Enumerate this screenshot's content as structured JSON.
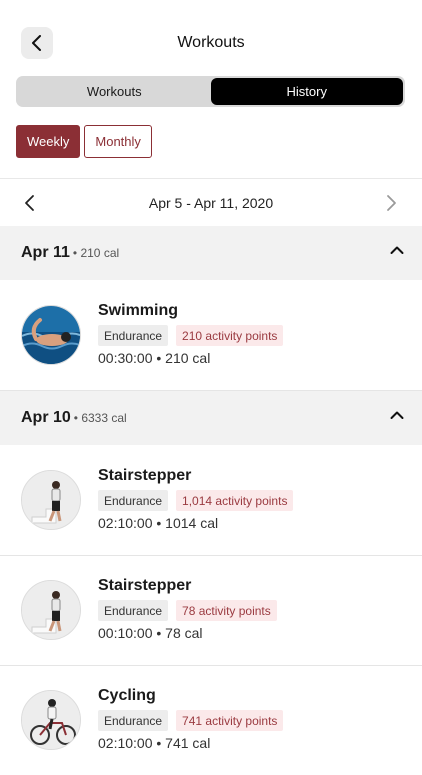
{
  "header": {
    "title": "Workouts"
  },
  "tabs": [
    {
      "label": "Workouts",
      "active": false
    },
    {
      "label": "History",
      "active": true
    }
  ],
  "period": {
    "weekly": "Weekly",
    "monthly": "Monthly"
  },
  "range": {
    "label": "Apr 5 - Apr 11, 2020"
  },
  "days": [
    {
      "date": "Apr 11",
      "cal": "• 210 cal",
      "workouts": [
        {
          "name": "Swimming",
          "category": "Endurance",
          "points": "210 activity points",
          "stats": "00:30:00 • 210 cal",
          "icon": "swimming-icon"
        }
      ]
    },
    {
      "date": "Apr 10",
      "cal": "• 6333 cal",
      "workouts": [
        {
          "name": "Stairstepper",
          "category": "Endurance",
          "points": "1,014 activity points",
          "stats": "02:10:00 • 1014 cal",
          "icon": "stairstepper-icon"
        },
        {
          "name": "Stairstepper",
          "category": "Endurance",
          "points": "78 activity points",
          "stats": "00:10:00 • 78 cal",
          "icon": "stairstepper-icon"
        },
        {
          "name": "Cycling",
          "category": "Endurance",
          "points": "741 activity points",
          "stats": "02:10:00 • 741 cal",
          "icon": "cycling-icon"
        }
      ]
    }
  ],
  "colors": {
    "accent": "#8b2f35",
    "points_bg": "#fbe9ea",
    "section_bg": "#f2f2f2"
  }
}
